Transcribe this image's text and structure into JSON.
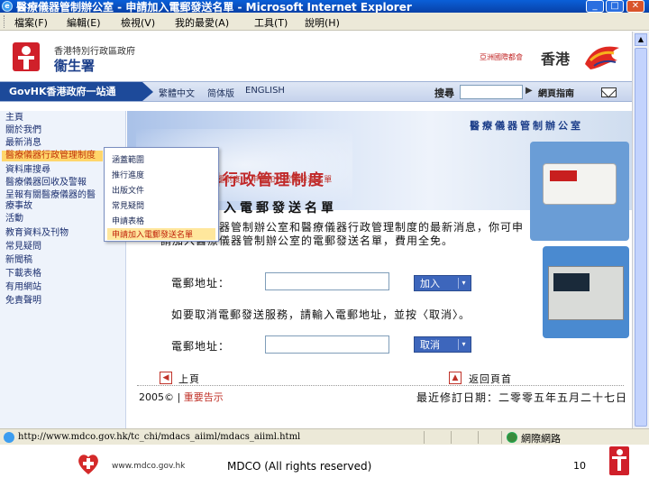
{
  "window": {
    "title": "醫療儀器管制辦公室 - 申請加入電郵發送名單 - Microsoft Internet Explorer",
    "buttons": [
      "_",
      "□",
      "✕"
    ]
  },
  "menu": [
    "檔案(F)",
    "編輯(E)",
    "檢視(V)",
    "我的最愛(A)",
    "工具(T)",
    "說明(H)"
  ],
  "header": {
    "gov_name": "香港特別行政區政府",
    "dept_name": "衞生署",
    "asia_city": "亞洲國際都會",
    "hk": "香港"
  },
  "navbar": {
    "govhk": "GovHK香港政府一站通",
    "links": [
      "繁體中文",
      "简体版",
      "ENGLISH"
    ],
    "search_label": "搜尋",
    "sitemap": "網頁指南"
  },
  "sidebar": {
    "items": [
      "主頁",
      "關於我們",
      "最新消息",
      "醫療儀器行政管理制度",
      "資料庫搜尋",
      "醫療儀器回收及警報",
      "呈報有關醫療儀器的醫療事故",
      "活動",
      "教育資料及刊物",
      "常見疑問",
      "新聞稿",
      "下載表格",
      "有用網站",
      "免責聲明"
    ]
  },
  "submenu": {
    "items": [
      "涵蓋範圍",
      "推行進度",
      "出版文件",
      "常見疑問",
      "申請表格",
      "申請加入電郵發送名單"
    ]
  },
  "main": {
    "office_name": "醫療儀器管制辦公室",
    "heading": "醫療儀器行政管理制度",
    "breadcrumb": "理制度 » 申請加入電郵發送名單",
    "subheading": "入電郵發送名單",
    "body": "有關醫療儀器管制辦公室和醫療儀器行政管理制度的最新消息，你可申請加入醫療儀器管制辦公室的電郵發送名單，費用全免。",
    "email_label": "電郵地址：",
    "join_btn": "加入",
    "cancel_note": "如要取消電郵發送服務，請輸入電郵地址，並按〈取消〉。",
    "cancel_btn": "取消",
    "prev_page": "上頁",
    "back_top": "返回頁首",
    "copyright": "2005©",
    "important": "重要告示",
    "revised": "最近修訂日期：二零零五年五月二十七日"
  },
  "statusbar": {
    "url": "http://www.mdco.gov.hk/tc_chi/mdacs_aiiml/mdacs_aiiml.html",
    "zone": "網際網路"
  },
  "slide_footer": {
    "url": "www.mdco.gov.hk",
    "center": "MDCO (All rights reserved)",
    "page": "10"
  }
}
